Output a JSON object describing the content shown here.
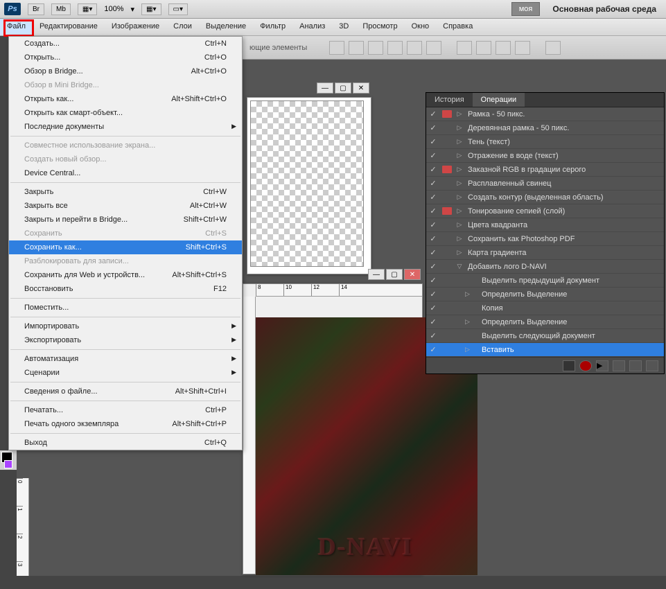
{
  "topbar": {
    "zoom": "100%",
    "workspace_btn": "моя",
    "workspace_label": "Основная рабочая среда"
  },
  "menubar": [
    "Файл",
    "Редактирование",
    "Изображение",
    "Слои",
    "Выделение",
    "Фильтр",
    "Анализ",
    "3D",
    "Просмотр",
    "Окно",
    "Справка"
  ],
  "toolbar2_text": "ющие элементы",
  "file_menu": [
    {
      "label": "Создать...",
      "shortcut": "Ctrl+N",
      "type": "item"
    },
    {
      "label": "Открыть...",
      "shortcut": "Ctrl+O",
      "type": "item"
    },
    {
      "label": "Обзор в Bridge...",
      "shortcut": "Alt+Ctrl+O",
      "type": "item"
    },
    {
      "label": "Обзор в Mini Bridge...",
      "shortcut": "",
      "type": "disabled"
    },
    {
      "label": "Открыть как...",
      "shortcut": "Alt+Shift+Ctrl+O",
      "type": "item"
    },
    {
      "label": "Открыть как смарт-объект...",
      "shortcut": "",
      "type": "item"
    },
    {
      "label": "Последние документы",
      "shortcut": "",
      "type": "submenu"
    },
    {
      "type": "sep"
    },
    {
      "label": "Совместное использование экрана...",
      "shortcut": "",
      "type": "disabled"
    },
    {
      "label": "Создать новый обзор...",
      "shortcut": "",
      "type": "disabled"
    },
    {
      "label": "Device Central...",
      "shortcut": "",
      "type": "item"
    },
    {
      "type": "sep"
    },
    {
      "label": "Закрыть",
      "shortcut": "Ctrl+W",
      "type": "item"
    },
    {
      "label": "Закрыть все",
      "shortcut": "Alt+Ctrl+W",
      "type": "item"
    },
    {
      "label": "Закрыть и перейти в Bridge...",
      "shortcut": "Shift+Ctrl+W",
      "type": "item"
    },
    {
      "label": "Сохранить",
      "shortcut": "Ctrl+S",
      "type": "disabled"
    },
    {
      "label": "Сохранить как...",
      "shortcut": "Shift+Ctrl+S",
      "type": "highlighted"
    },
    {
      "label": "Разблокировать для записи...",
      "shortcut": "",
      "type": "disabled"
    },
    {
      "label": "Сохранить для Web и устройств...",
      "shortcut": "Alt+Shift+Ctrl+S",
      "type": "item"
    },
    {
      "label": "Восстановить",
      "shortcut": "F12",
      "type": "item"
    },
    {
      "type": "sep"
    },
    {
      "label": "Поместить...",
      "shortcut": "",
      "type": "item"
    },
    {
      "type": "sep"
    },
    {
      "label": "Импортировать",
      "shortcut": "",
      "type": "submenu"
    },
    {
      "label": "Экспортировать",
      "shortcut": "",
      "type": "submenu"
    },
    {
      "type": "sep"
    },
    {
      "label": "Автоматизация",
      "shortcut": "",
      "type": "submenu"
    },
    {
      "label": "Сценарии",
      "shortcut": "",
      "type": "submenu"
    },
    {
      "type": "sep"
    },
    {
      "label": "Сведения о файле...",
      "shortcut": "Alt+Shift+Ctrl+I",
      "type": "item"
    },
    {
      "type": "sep"
    },
    {
      "label": "Печатать...",
      "shortcut": "Ctrl+P",
      "type": "item"
    },
    {
      "label": "Печать одного экземпляра",
      "shortcut": "Alt+Shift+Ctrl+P",
      "type": "item"
    },
    {
      "type": "sep"
    },
    {
      "label": "Выход",
      "shortcut": "Ctrl+Q",
      "type": "item"
    }
  ],
  "panels": {
    "tab_history": "История",
    "tab_actions": "Операции",
    "actions": [
      {
        "label": "Рамка - 50 пикс.",
        "check": true,
        "folder": true,
        "expand": ">",
        "level": 0
      },
      {
        "label": "Деревянная рамка - 50 пикс.",
        "check": true,
        "folder": false,
        "expand": ">",
        "level": 0
      },
      {
        "label": "Тень (текст)",
        "check": true,
        "folder": false,
        "expand": ">",
        "level": 0
      },
      {
        "label": "Отражение в воде (текст)",
        "check": true,
        "folder": false,
        "expand": ">",
        "level": 0
      },
      {
        "label": "Заказной RGB в градации серого",
        "check": true,
        "folder": true,
        "expand": ">",
        "level": 0
      },
      {
        "label": "Расплавленный свинец",
        "check": true,
        "folder": false,
        "expand": ">",
        "level": 0
      },
      {
        "label": "Создать контур (выделенная область)",
        "check": true,
        "folder": false,
        "expand": ">",
        "level": 0
      },
      {
        "label": "Тонирование сепией (слой)",
        "check": true,
        "folder": true,
        "expand": ">",
        "level": 0
      },
      {
        "label": "Цвета квадранта",
        "check": true,
        "folder": false,
        "expand": ">",
        "level": 0
      },
      {
        "label": "Сохранить как Photoshop PDF",
        "check": true,
        "folder": false,
        "expand": ">",
        "level": 0
      },
      {
        "label": "Карта градиента",
        "check": true,
        "folder": false,
        "expand": ">",
        "level": 0
      },
      {
        "label": "Добавить лого D-NAVI",
        "check": true,
        "folder": false,
        "expand": "v",
        "level": 0
      },
      {
        "label": "Выделить  предыдущий документ",
        "check": true,
        "folder": false,
        "expand": "",
        "level": 1
      },
      {
        "label": "Определить Выделение",
        "check": true,
        "folder": false,
        "expand": ">",
        "level": 1
      },
      {
        "label": "Копия",
        "check": true,
        "folder": false,
        "expand": "",
        "level": 1
      },
      {
        "label": "Определить Выделение",
        "check": true,
        "folder": false,
        "expand": ">",
        "level": 1
      },
      {
        "label": "Выделить  следующий документ",
        "check": true,
        "folder": false,
        "expand": "",
        "level": 1
      },
      {
        "label": "Вставить",
        "check": true,
        "folder": false,
        "expand": ">",
        "level": 1,
        "selected": true
      }
    ]
  },
  "ruler_h": [
    "8",
    "10",
    "12",
    "14"
  ],
  "ruler_v": [
    "0",
    "1",
    "2",
    "3"
  ],
  "texture_text": "D-NAVI"
}
